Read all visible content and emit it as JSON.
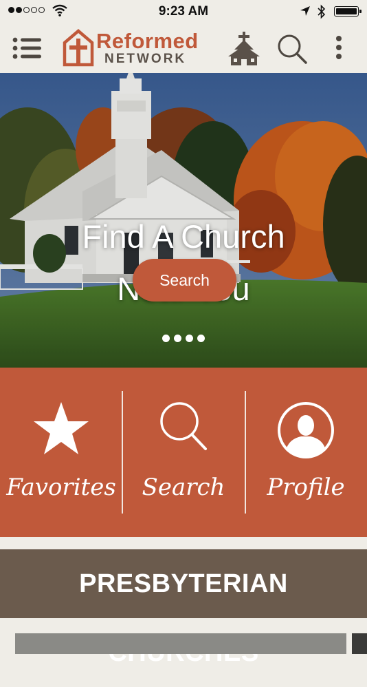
{
  "status_bar": {
    "time": "9:23 AM"
  },
  "brand": {
    "name": "Reformed",
    "sub": "NETWORK",
    "accent": "#c0593a",
    "dark": "#5a5149"
  },
  "hero": {
    "title_line1": "Find A Church",
    "title_line2": "Near You",
    "search_label": "Search",
    "slide_count": 4,
    "active_slide": 1
  },
  "quick_actions": [
    {
      "label": "Favorites",
      "icon": "star-icon"
    },
    {
      "label": "Search",
      "icon": "search-icon"
    },
    {
      "label": "Profile",
      "icon": "profile-icon"
    }
  ],
  "section": {
    "title": "PRESBYTERIAN CHURCHES",
    "color": "#6b5b4d"
  }
}
